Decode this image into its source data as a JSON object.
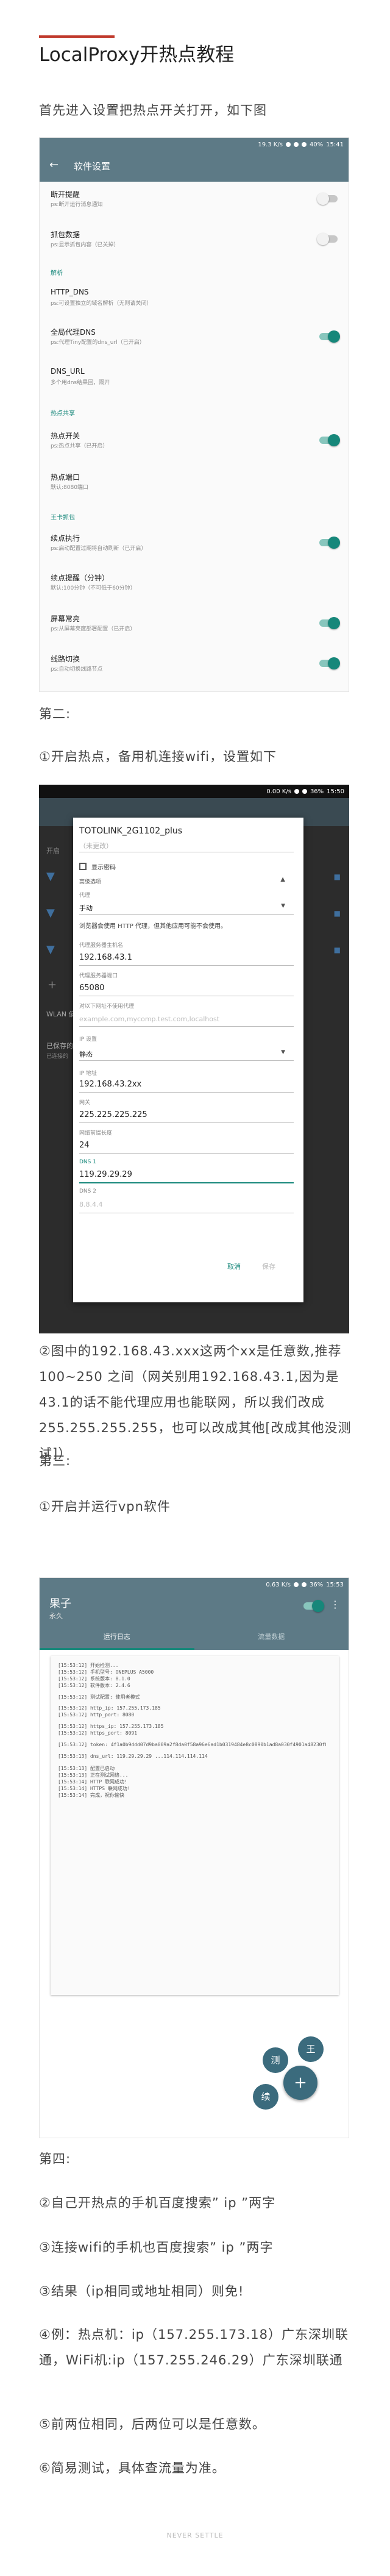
{
  "article": {
    "title": "LocalProxy开热点教程",
    "intro": "首先进入设置把热点开关打开，如下图",
    "step2_heading": "第二:",
    "step2_p1": "①开启热点，备用机连接wifi，设置如下",
    "step2_p2": "②图中的192.168.43.xxx这两个xx是任意数,推荐100~250 之间（网关别用192.168.43.1,因为是43.1的话不能代理应用也能联网，所以我们改成255.255.255.255，也可以改成其他[改成其他没测试]）",
    "step3_heading": "第三:",
    "step3_p1": "①开启并运行vpn软件",
    "step4_heading": "第四:",
    "step4_items": [
      "②自己开热点的手机百度搜索” ip ”两字",
      "③连接wifi的手机也百度搜索” ip ”两字",
      "③结果（ip相同或地址相同）则免!",
      "④例：热点机：ip（157.255.173.18）广东深圳联通，WiFi机:ip（157.255.246.29）广东深圳联通",
      "⑤前两位相同，后两位可以是任意数。",
      "⑥简易测试，具体查流量为准。"
    ],
    "footer": "NEVER SETTLE",
    "accent": "#c0392b"
  },
  "shot1": {
    "status": {
      "speed": "19.3 K/s",
      "battery": "40%",
      "time": "15:41"
    },
    "title": "软件设置",
    "back_icon": "arrow-left-icon",
    "header_color": "#5d7a86",
    "rows_top": [
      {
        "title": "断开提醒",
        "sub": "ps:断开运行消息通知",
        "on": false
      },
      {
        "title": "抓包数据",
        "sub": "ps:显示抓包内容（已关掉）",
        "on": false
      }
    ],
    "sec_parse": "解析",
    "rows_parse": [
      {
        "title": "HTTP_DNS",
        "sub": "ps:可设置独立的域名解析（无则请关闭）"
      },
      {
        "title": "全局代理DNS",
        "sub": "ps:代理Tiny配置的dns_url（已开启）",
        "on": true
      },
      {
        "title": "DNS_URL",
        "sub": "多个用dns结果回，隔开"
      }
    ],
    "sec_hotspot": "热点共享",
    "rows_hotspot": [
      {
        "title": "热点开关",
        "sub": "ps:热点共享（已开启）",
        "on": true
      },
      {
        "title": "热点端口",
        "sub": "默认:8080端口"
      }
    ],
    "sec_misc": "王卡抓包",
    "rows_misc": [
      {
        "title": "续点执行",
        "sub": "ps:启动配置过期将自动刷新（已开启）",
        "on": true
      },
      {
        "title": "续点提醒（分钟）",
        "sub": "默认:100分钟（不可低于60分钟）"
      },
      {
        "title": "屏幕常亮",
        "sub": "ps:从屏幕亮度部署配置（已开启）",
        "on": true
      },
      {
        "title": "线路切换",
        "sub": "ps:自动切换线路节点",
        "on": true
      }
    ]
  },
  "shot2": {
    "status": {
      "speed": "0.00 K/s",
      "battery": "36%",
      "time": "15:50"
    },
    "dialog_title": "TOTOLINK_2G1102_plus",
    "password_placeholder": "（未更改）",
    "show_password": "显示密码",
    "advanced": "高级选项",
    "proxy_label": "代理",
    "proxy_value": "手动",
    "proxy_note": "浏览器会使用 HTTP 代理，但其他应用可能不会使用。",
    "proxy_host_label": "代理服务器主机名",
    "proxy_host": "192.168.43.1",
    "proxy_port_label": "代理服务器端口",
    "proxy_port": "65080",
    "bypass_label": "对以下网址不使用代理",
    "bypass_placeholder": "example.com,mycomp.test.com,localhost",
    "ip_settings_label": "IP 设置",
    "ip_settings_value": "静态",
    "ip_label": "IP 地址",
    "ip_value": "192.168.43.2xx",
    "gateway_label": "网关",
    "gateway_value": "225.225.225.225",
    "prefix_label": "网络前缀长度",
    "prefix_value": "24",
    "dns1_label": "DNS 1",
    "dns1_value": "119.29.29.29",
    "dns2_label": "DNS 2",
    "dns2_value": "8.8.4.4",
    "cancel": "取消",
    "save": "保存",
    "bg_label_1": "开启",
    "bg_label_2": "WLAN 偏",
    "bg_label_3": "已保存的",
    "bg_label_4": "已连接的"
  },
  "shot3": {
    "status": {
      "speed": "0.63 K/s",
      "battery": "36%",
      "time": "15:53"
    },
    "app_title": "果子",
    "app_sub": "永久",
    "tab_log": "运行日志",
    "tab_flow": "流量数据",
    "logs": [
      "[15:53:12] 开始检测...",
      "[15:53:12] 手机型号: ONEPLUS A5000",
      "[15:53:12] 系统版本: 8.1.0",
      "[15:53:12] 软件版本: 2.4.6",
      "",
      "[15:53:12] 测试配置: 使用者模式",
      "",
      "[15:53:12] http_ip: 157.255.173.185",
      "[15:53:12] http_port: 8080",
      "",
      "[15:53:12] https_ip: 157.255.173.185",
      "[15:53:12] https_port: 8091",
      "",
      "[15:53:12] token:  4f1a0b9ddd07d9ba009a2f8da0f58a96e6ad1b0319484e8c0890b1ad8a030f4901a48230f06c7bdb6ab8a0faf735128",
      "",
      "[15:53:13] dns_url: 119.29.29.29 ...114.114.114.114",
      "",
      "[15:53:13] 配置已启动",
      "[15:53:13] 正在测试网络...",
      "[15:53:14] HTTP 联网成功!",
      "[15:53:14] HTTPS 联网成功!",
      "[15:53:14] 完成，祝你愉快"
    ],
    "fab_user": "王",
    "fab_test": "测",
    "fab_continue": "续",
    "fab_add": "+"
  }
}
